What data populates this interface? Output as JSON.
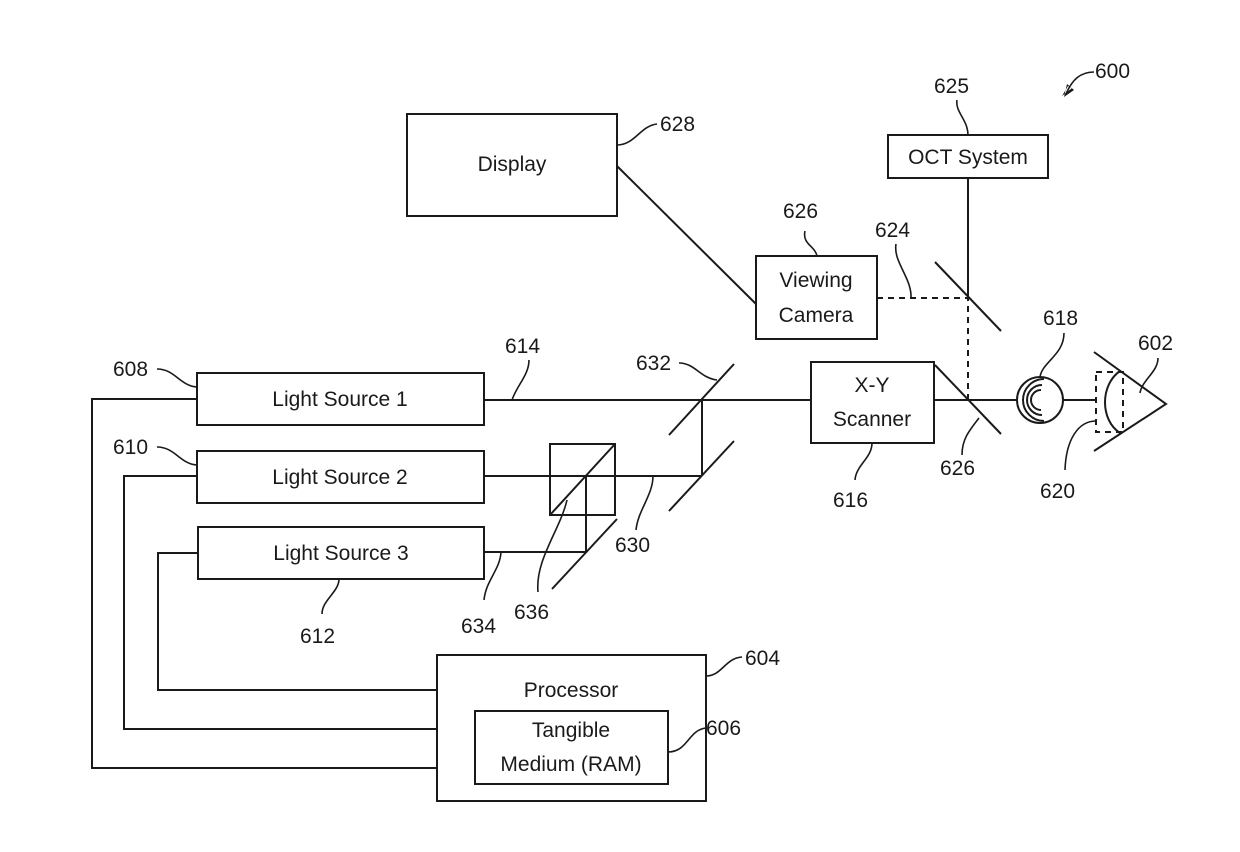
{
  "figure": {
    "figure_ref": "600",
    "components": {
      "display": {
        "label": "Display",
        "ref": "628"
      },
      "oct_system": {
        "label": "OCT System",
        "ref": "625"
      },
      "viewing_camera": {
        "label_line1": "Viewing",
        "label_line2": "Camera",
        "ref": "626"
      },
      "xy_scanner": {
        "label_line1": "X-Y",
        "label_line2": "Scanner",
        "ref": "616"
      },
      "light_source_1": {
        "label": "Light Source 1",
        "ref": "608"
      },
      "light_source_2": {
        "label": "Light Source 2",
        "ref": "610"
      },
      "light_source_3": {
        "label": "Light Source 3",
        "ref": "612"
      },
      "processor": {
        "label": "Processor",
        "ref": "604"
      },
      "tangible_medium": {
        "label_line1": "Tangible",
        "label_line2": "Medium (RAM)",
        "ref": "606"
      }
    },
    "refs": {
      "beam_614": "614",
      "dashed_path_624": "624",
      "mirror_632": "632",
      "beam_630": "630",
      "beam_634": "634",
      "beam_splitter_636": "636",
      "scanner_mirror_626": "626",
      "lens_618": "618",
      "contact_620": "620",
      "eye_602": "602"
    }
  }
}
